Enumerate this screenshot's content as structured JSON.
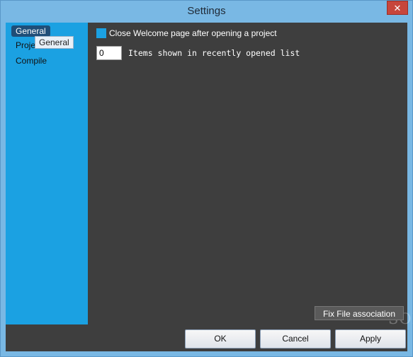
{
  "window": {
    "title": "Settings",
    "close_symbol": "✕",
    "accent_color": "#1ba1e2",
    "content_bg": "#3e3e3e"
  },
  "sidebar": {
    "items": [
      {
        "label": "General",
        "selected": true
      },
      {
        "label": "Proje"
      },
      {
        "label": "Compile"
      }
    ],
    "tooltip": "General"
  },
  "general": {
    "close_welcome": {
      "label": "Close Welcome page after opening a project",
      "checked": true
    },
    "recent_items": {
      "value": "0",
      "label": "Items shown in recently opened list"
    },
    "fix_association_label": "Fix File association"
  },
  "footer": {
    "ok_label": "OK",
    "cancel_label": "Cancel",
    "apply_label": "Apply"
  },
  "watermark": "SOFTPEDIA"
}
